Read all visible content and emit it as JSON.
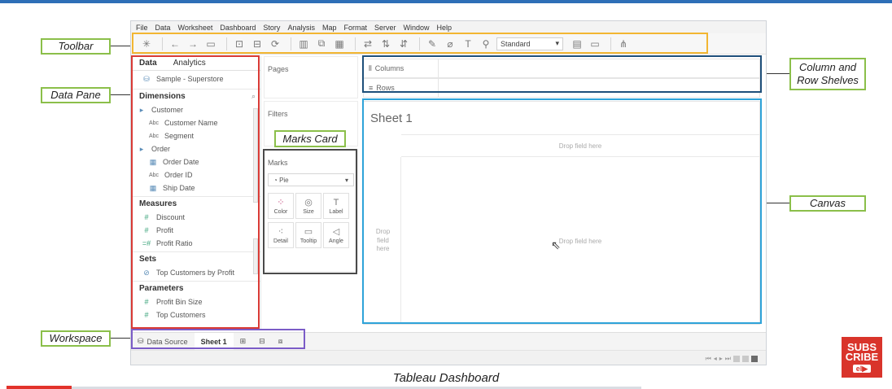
{
  "callouts": {
    "toolbar": "Toolbar",
    "data_pane": "Data Pane",
    "workspace": "Workspace",
    "marks_card": "Marks Card",
    "column_row_line1": "Column and",
    "column_row_line2": "Row Shelves",
    "canvas": "Canvas"
  },
  "highlight_colors": {
    "toolbar": "#f2b632",
    "data_pane": "#d93a35",
    "marks": "#4a4a4a",
    "shelves": "#1e4f7a",
    "canvas": "#2ea3d9",
    "workspace": "#7b5cc7",
    "callout_border": "#8bbf4a"
  },
  "menu": [
    "File",
    "Data",
    "Worksheet",
    "Dashboard",
    "Story",
    "Analysis",
    "Map",
    "Format",
    "Server",
    "Window",
    "Help"
  ],
  "toolbar": {
    "fit_select": "Standard"
  },
  "data_pane": {
    "tab_data": "Data",
    "tab_analytics": "Analytics",
    "datasource": "Sample - Superstore",
    "dimensions_label": "Dimensions",
    "dimensions": [
      {
        "label": "Customer",
        "type": "folder",
        "level": 0
      },
      {
        "label": "Customer Name",
        "type": "abc",
        "level": 1
      },
      {
        "label": "Segment",
        "type": "abc",
        "level": 1
      },
      {
        "label": "Order",
        "type": "folder",
        "level": 0
      },
      {
        "label": "Order Date",
        "type": "date",
        "level": 1
      },
      {
        "label": "Order ID",
        "type": "abc",
        "level": 1
      },
      {
        "label": "Ship Date",
        "type": "date",
        "level": 1
      }
    ],
    "measures_label": "Measures",
    "measures": [
      "Discount",
      "Profit",
      "Profit Ratio"
    ],
    "sets_label": "Sets",
    "sets": [
      "Top Customers by Profit"
    ],
    "parameters_label": "Parameters",
    "parameters": [
      "Profit Bin Size",
      "Top Customers"
    ]
  },
  "shelves": {
    "pages": "Pages",
    "filters": "Filters",
    "columns": "Columns",
    "rows": "Rows"
  },
  "marks": {
    "title": "Marks",
    "type": "Pie",
    "buttons": [
      "Color",
      "Size",
      "Label",
      "Detail",
      "Tooltip",
      "Angle"
    ]
  },
  "canvas": {
    "sheet_title": "Sheet 1",
    "drop_here": "Drop field here",
    "drop_left_1": "Drop",
    "drop_left_2": "field",
    "drop_left_3": "here"
  },
  "tabs": {
    "data_source": "Data Source",
    "sheet1": "Sheet 1"
  },
  "caption": "Tableau Dashboard",
  "subscribe": {
    "line1": "SUBS",
    "line2": "CRIBE",
    "badge": "el"
  }
}
